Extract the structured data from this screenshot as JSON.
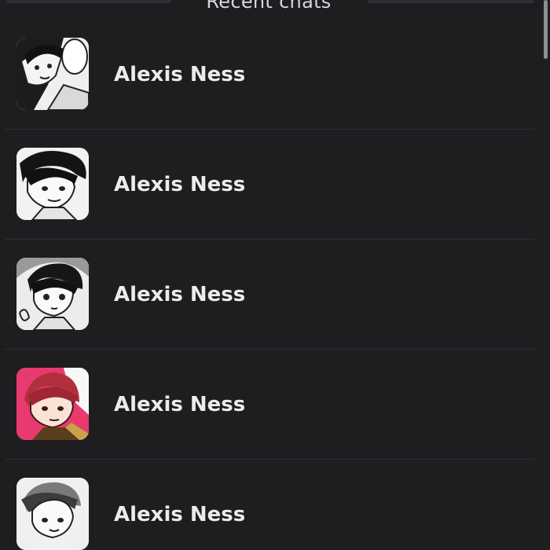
{
  "header": {
    "title": "Recent chats"
  },
  "chats": [
    {
      "name": "Alexis Ness",
      "avatar_icon": "manga-portrait-avatar"
    },
    {
      "name": "Alexis Ness",
      "avatar_icon": "manga-portrait-avatar"
    },
    {
      "name": "Alexis Ness",
      "avatar_icon": "manga-portrait-avatar"
    },
    {
      "name": "Alexis Ness",
      "avatar_icon": "manga-portrait-avatar-color"
    },
    {
      "name": "Alexis Ness",
      "avatar_icon": "manga-portrait-avatar"
    }
  ],
  "colors": {
    "background": "#1e1e20",
    "divider": "#2d2e31",
    "text": "#ececef",
    "scrollbar": "#8e8e93",
    "avatar_accent": "#e83a6e"
  }
}
